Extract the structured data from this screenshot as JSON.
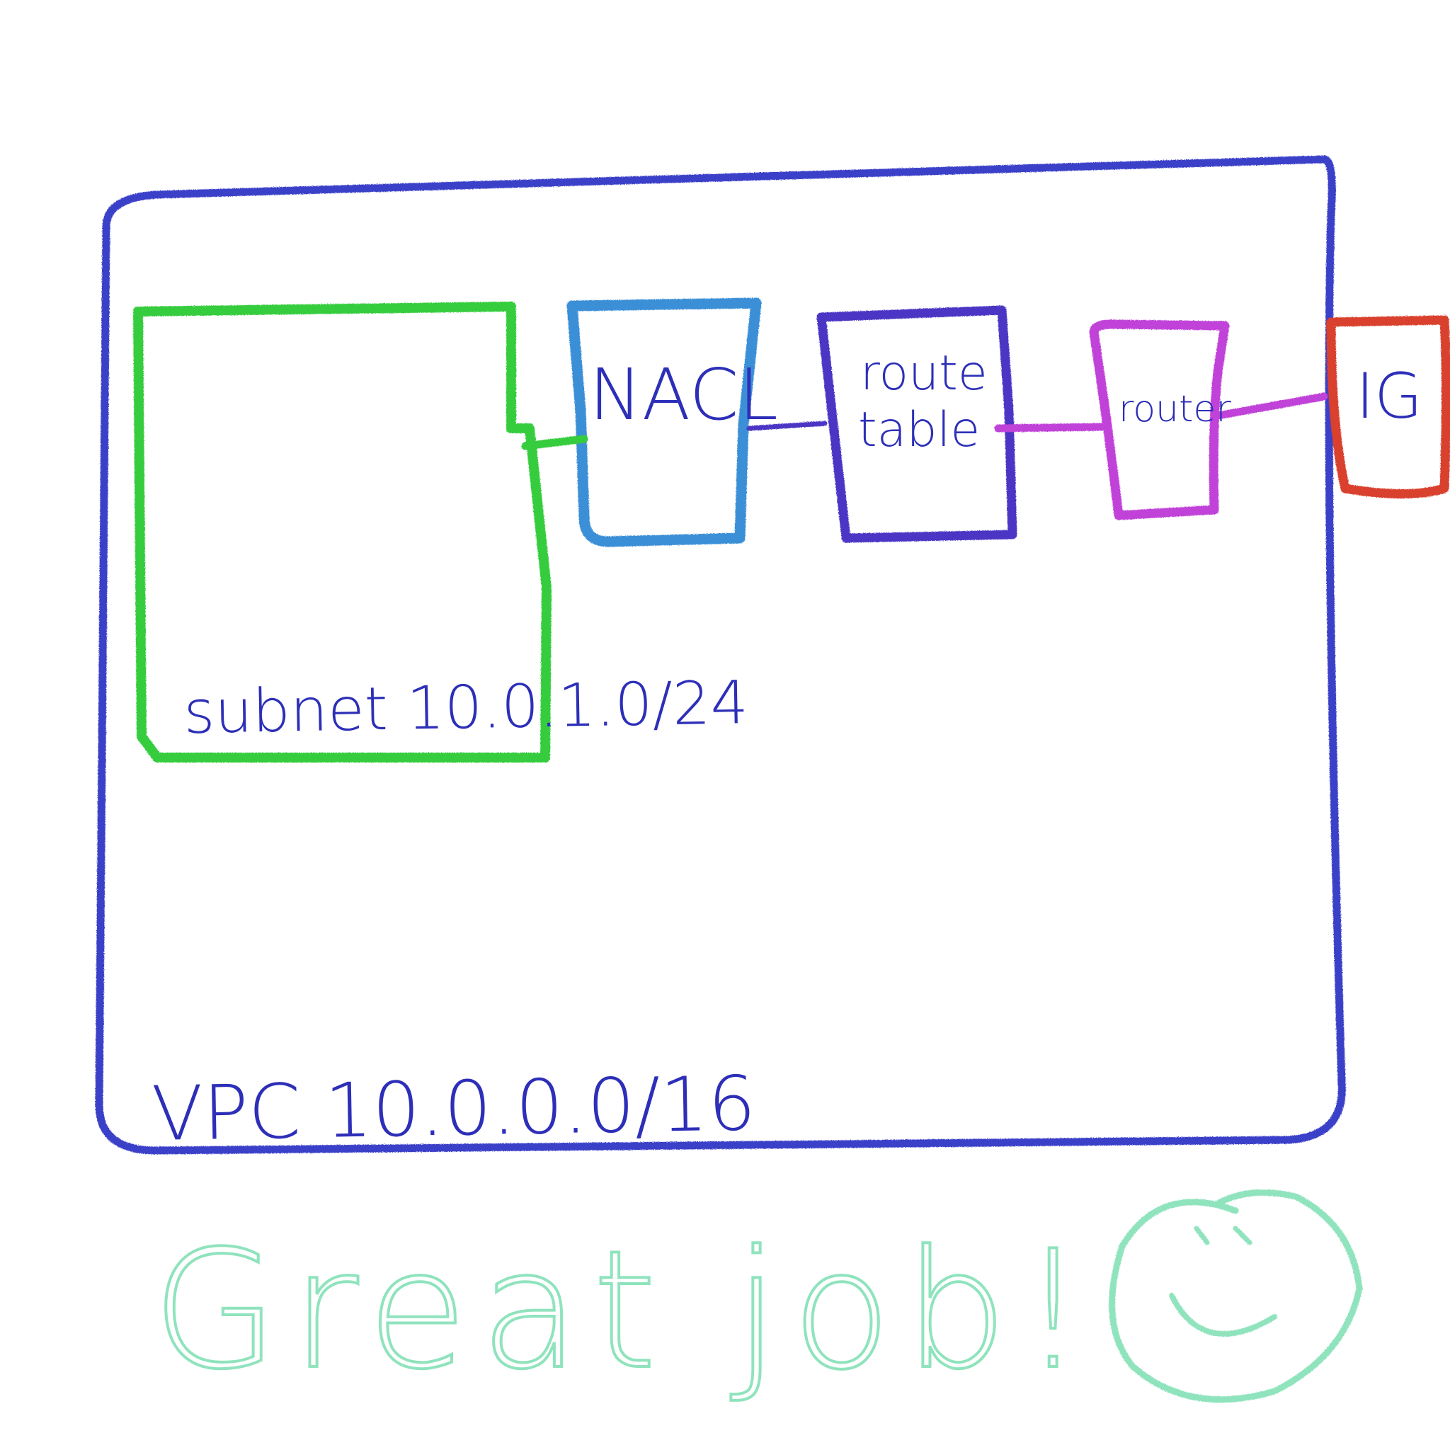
{
  "diagram": {
    "vpc_label": "VPC 10.0.0.0/16",
    "subnet_label": "subnet 10.0.1.0/24",
    "nacl_label": "NACL",
    "route_table_label_line1": "route",
    "route_table_label_line2": "table",
    "router_label": "router",
    "igw_label": "IG",
    "footer_text": "Great job!"
  },
  "colors": {
    "vpc": "#3b3fc8",
    "subnet": "#34cc3d",
    "nacl": "#3a8fd6",
    "route_table": "#4b36c4",
    "router": "#c043d8",
    "igw": "#d9402e",
    "label_text": "#2d2fb8",
    "footer": "#8fe3bd"
  }
}
